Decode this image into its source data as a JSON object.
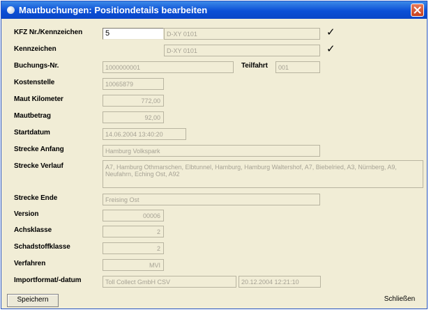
{
  "window": {
    "title": "Mautbuchungen: Positiondetails bearbeiten"
  },
  "fields": {
    "kfz_label": "KFZ Nr./Kennzeichen",
    "kfz_value": "5",
    "kfz_plate": "D-XY 0101",
    "kennzeichen_label": "Kennzeichen",
    "kennzeichen_value": "D-XY 0101",
    "buchungs_label": "Buchungs-Nr.",
    "buchungs_value": "1000000001",
    "teilfahrt_label": "Teilfahrt",
    "teilfahrt_value": "001",
    "kostenstelle_label": "Kostenstelle",
    "kostenstelle_value": "10065879",
    "maut_km_label": "Maut Kilometer",
    "maut_km_value": "772,00",
    "mautbetrag_label": "Mautbetrag",
    "mautbetrag_value": "92,00",
    "startdatum_label": "Startdatum",
    "startdatum_value": "14.06.2004 13:40:20",
    "strecke_anfang_label": "Strecke Anfang",
    "strecke_anfang_value": "Hamburg Volkspark",
    "strecke_verlauf_label": "Strecke Verlauf",
    "strecke_verlauf_value": "A7, Hamburg Othmarschen, Elbtunnel, Hamburg, Hamburg Waltershof, A7, Biebelried, A3, Nürnberg, A9, Neufahrn, Eching Ost, A92",
    "strecke_ende_label": "Strecke Ende",
    "strecke_ende_value": "Freising Ost",
    "version_label": "Version",
    "version_value": "00006",
    "achsklasse_label": "Achsklasse",
    "achsklasse_value": "2",
    "schadstoff_label": "Schadstoffklasse",
    "schadstoff_value": "2",
    "verfahren_label": "Verfahren",
    "verfahren_value": "MVI",
    "import_label": "Importformat/-datum",
    "import_format_value": "Toll Collect GmbH CSV",
    "import_date_value": "20.12.2004 12:21:10"
  },
  "checkmark": "✓",
  "buttons": {
    "save": "Speichern",
    "close": "Schließen"
  },
  "colors": {
    "titlebar": "#0b4fd6",
    "dialog_bg": "#f1edd6",
    "field_border": "#b8b4a0",
    "disabled_text": "#a6a294",
    "close_button": "#c7401e"
  }
}
